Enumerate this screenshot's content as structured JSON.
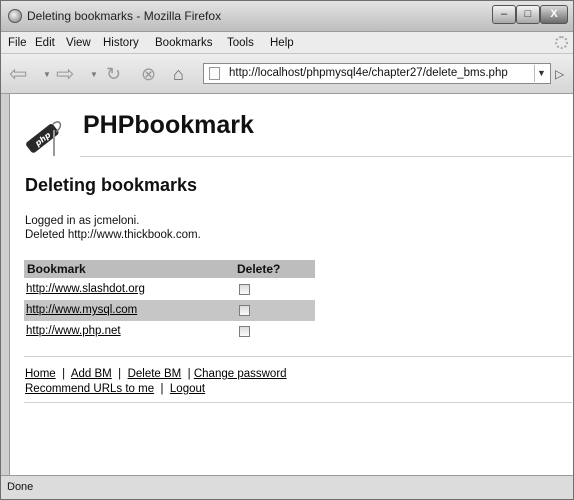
{
  "window": {
    "title": "Deleting bookmarks - Mozilla Firefox",
    "min_label": "–",
    "max_label": "□",
    "close_label": "X"
  },
  "menu": [
    "File",
    "Edit",
    "View",
    "History",
    "Bookmarks",
    "Tools",
    "Help"
  ],
  "address": {
    "url": "http://localhost/phpmysql4e/chapter27/delete_bms.php"
  },
  "page": {
    "brand": "PHPbookmark",
    "logo_text": "php",
    "heading": "Deleting bookmarks",
    "logged_in": "Logged in as jcmeloni.",
    "deleted": "Deleted http://www.thickbook.com.",
    "table_headers": {
      "bookmark": "Bookmark",
      "delete": "Delete?"
    },
    "bookmarks": [
      {
        "url": "http://www.slashdot.org",
        "checked": false
      },
      {
        "url": "http://www.mysql.com",
        "checked": false
      },
      {
        "url": "http://www.php.net",
        "checked": false
      }
    ],
    "links": {
      "home": "Home",
      "add": "Add BM",
      "delete": "Delete BM",
      "change_password": "Change password",
      "recommend": "Recommend URLs to me",
      "logout": "Logout",
      "separator": "|"
    }
  },
  "status": {
    "text": "Done"
  },
  "icons": {
    "app": "firefox-icon",
    "back": "back-arrow-icon",
    "forward": "forward-arrow-icon",
    "reload": "reload-icon",
    "stop": "stop-icon",
    "home": "home-icon",
    "page": "page-icon",
    "go": "go-arrow-icon",
    "throbber": "activity-throbber-icon"
  }
}
